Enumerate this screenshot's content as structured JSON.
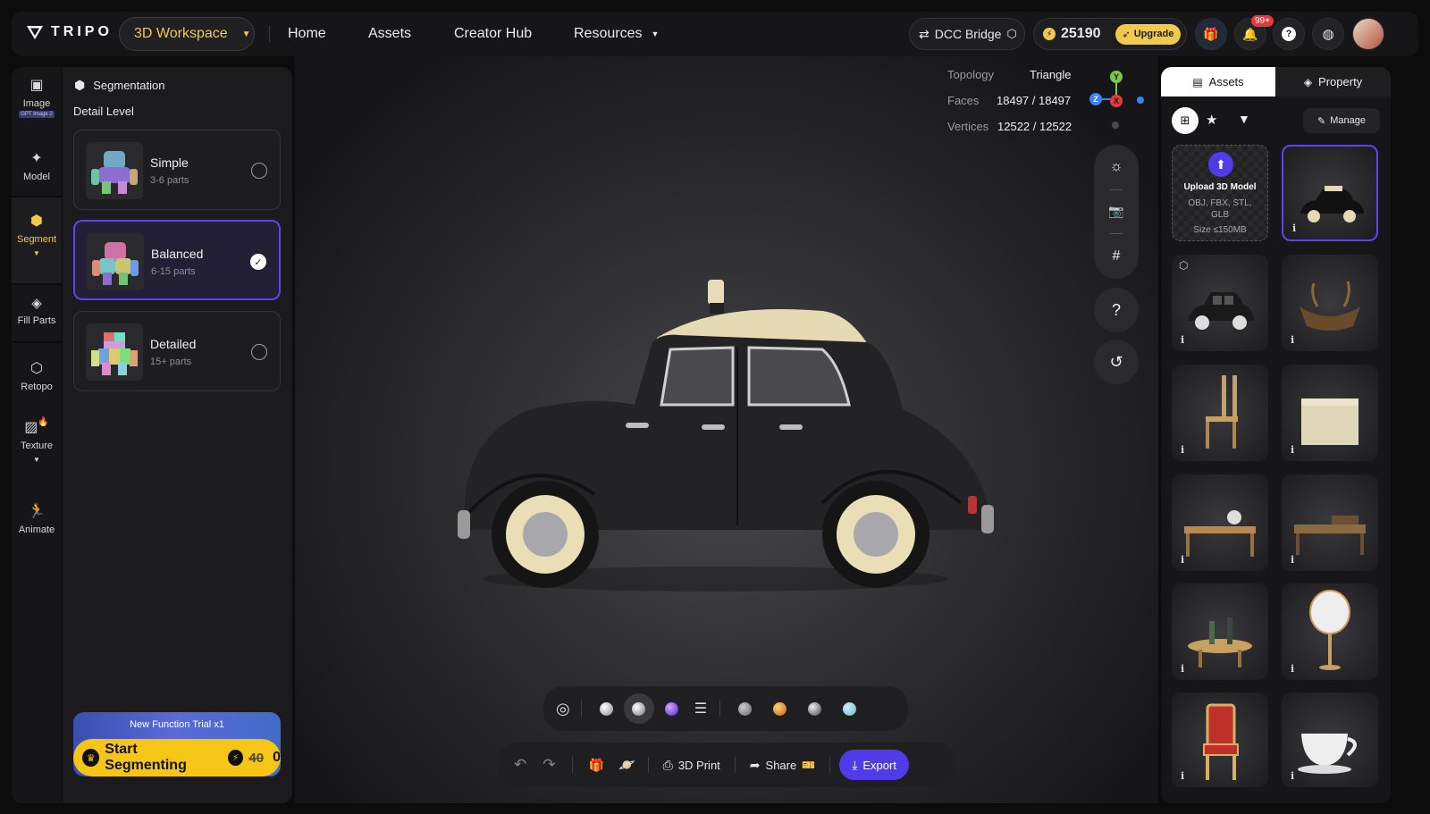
{
  "header": {
    "logo_text": "TRIPO",
    "workspace_label": "3D Workspace",
    "nav": [
      "Home",
      "Assets",
      "Creator Hub",
      "Resources"
    ],
    "dcc_bridge": "DCC Bridge",
    "credits": "25190",
    "upgrade": "Upgrade",
    "notif_badge": "99+"
  },
  "sidebar": {
    "items": [
      {
        "label": "Image",
        "badge": "GPT Image 2"
      },
      {
        "label": "Model"
      },
      {
        "label": "Segment"
      },
      {
        "label": "Fill Parts"
      },
      {
        "label": "Retopo"
      },
      {
        "label": "Texture"
      },
      {
        "label": "Animate"
      }
    ]
  },
  "segmentation": {
    "title": "Segmentation",
    "detail_level": "Detail Level",
    "options": [
      {
        "title": "Simple",
        "sub": "3-6 parts",
        "selected": false
      },
      {
        "title": "Balanced",
        "sub": "6-15 parts",
        "selected": true
      },
      {
        "title": "Detailed",
        "sub": "15+ parts",
        "selected": false
      }
    ],
    "trial_label": "New Function Trial x1",
    "start_label": "Start Segmenting",
    "old_cost": "40",
    "new_cost": "0"
  },
  "viewport": {
    "topology_label": "Topology",
    "topology_value": "Triangle",
    "faces_label": "Faces",
    "faces_value": "18497 / 18497",
    "vertices_label": "Vertices",
    "vertices_value": "12522 / 12522",
    "axis_y": "Y",
    "axis_z": "Z",
    "axis_x": "X",
    "help": "?"
  },
  "bottom_bar": {
    "print_label": "3D Print",
    "share_label": "Share",
    "export_label": "Export"
  },
  "assets_panel": {
    "tab_assets": "Assets",
    "tab_property": "Property",
    "manage": "Manage",
    "upload_title": "Upload 3D Model",
    "upload_formats": "OBJ, FBX, STL, GLB",
    "upload_size": "Size ≤150MB",
    "info": "i"
  },
  "colors": {
    "accent": "#5b45f0",
    "gold": "#f2c94c",
    "cta": "#f5c518"
  }
}
